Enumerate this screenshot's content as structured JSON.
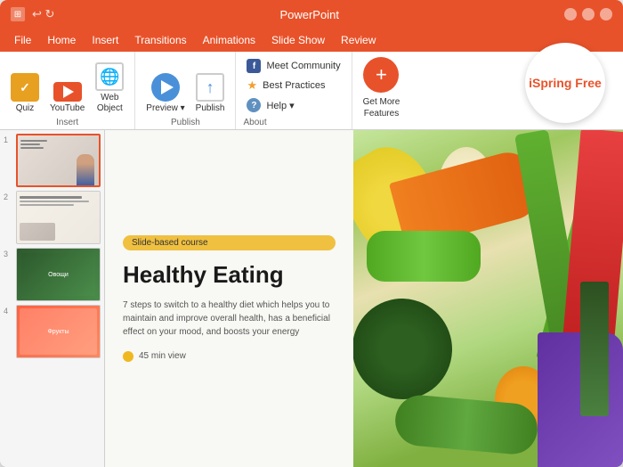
{
  "window": {
    "title": "PowerPoint",
    "controls": {
      "minimize": "—",
      "maximize": "□",
      "close": "✕"
    }
  },
  "menu": {
    "items": [
      "File",
      "Home",
      "Insert",
      "Transitions",
      "Animations",
      "Slide Show",
      "Review"
    ]
  },
  "ribbon": {
    "groups": [
      {
        "name": "Insert",
        "label": "Insert",
        "items": [
          {
            "id": "quiz",
            "label": "Quiz",
            "icon": "quiz-icon"
          },
          {
            "id": "youtube",
            "label": "YouTube",
            "icon": "youtube-icon"
          },
          {
            "id": "web-object",
            "label": "Web\nObject",
            "icon": "webobj-icon"
          }
        ]
      },
      {
        "name": "Publish",
        "label": "Publish",
        "items": [
          {
            "id": "preview",
            "label": "Preview",
            "icon": "preview-icon",
            "has_dropdown": true
          },
          {
            "id": "publish",
            "label": "Publish",
            "icon": "publish-icon"
          }
        ]
      },
      {
        "name": "About",
        "label": "About",
        "items": [
          {
            "id": "meet-community",
            "label": "Meet Community",
            "icon": "facebook-icon"
          },
          {
            "id": "best-practices",
            "label": "Best Practices",
            "icon": "star-icon"
          },
          {
            "id": "help",
            "label": "Help ▾",
            "icon": "help-icon"
          }
        ]
      },
      {
        "name": "GetMore",
        "label": "Get More\nFeatures",
        "items": []
      }
    ],
    "ispring": {
      "label": "iSpring Free"
    }
  },
  "slides": [
    {
      "num": "1",
      "active": true
    },
    {
      "num": "2",
      "active": false
    },
    {
      "num": "3",
      "active": false
    },
    {
      "num": "4",
      "active": false
    }
  ],
  "slide_content": {
    "badge": "Slide-based course",
    "title": "Healthy Eating",
    "description": "7 steps to switch to a healthy diet which helps you to maintain and improve overall health, has a beneficial effect on your mood, and boosts your energy",
    "duration": "45 min view"
  },
  "colors": {
    "accent": "#e8522a",
    "yellow": "#f0c040",
    "blue": "#4a90d9",
    "white": "#ffffff"
  }
}
